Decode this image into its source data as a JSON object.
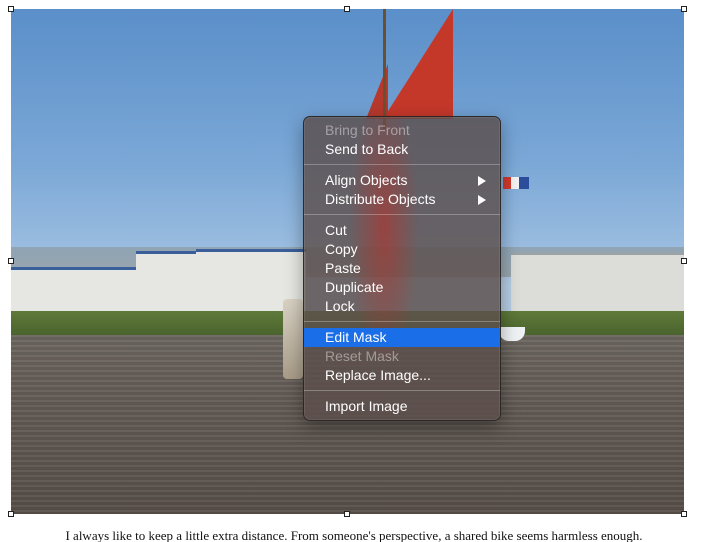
{
  "context_menu": {
    "bring_to_front": "Bring to Front",
    "send_to_back": "Send to Back",
    "align_objects": "Align Objects",
    "distribute_objects": "Distribute Objects",
    "cut": "Cut",
    "copy": "Copy",
    "paste": "Paste",
    "duplicate": "Duplicate",
    "lock": "Lock",
    "edit_mask": "Edit Mask",
    "reset_mask": "Reset Mask",
    "replace_image": "Replace Image...",
    "import_image": "Import Image"
  },
  "icons": {
    "submenu": "chevron-right-icon"
  },
  "colors": {
    "highlight": "#1a6ee8",
    "menu_background": "#5c4e4c",
    "sail": "#c4382a"
  },
  "document": {
    "caption_partial": "I always like to keep a little extra distance. From someone's perspective, a shared bike seems harmless enough."
  }
}
